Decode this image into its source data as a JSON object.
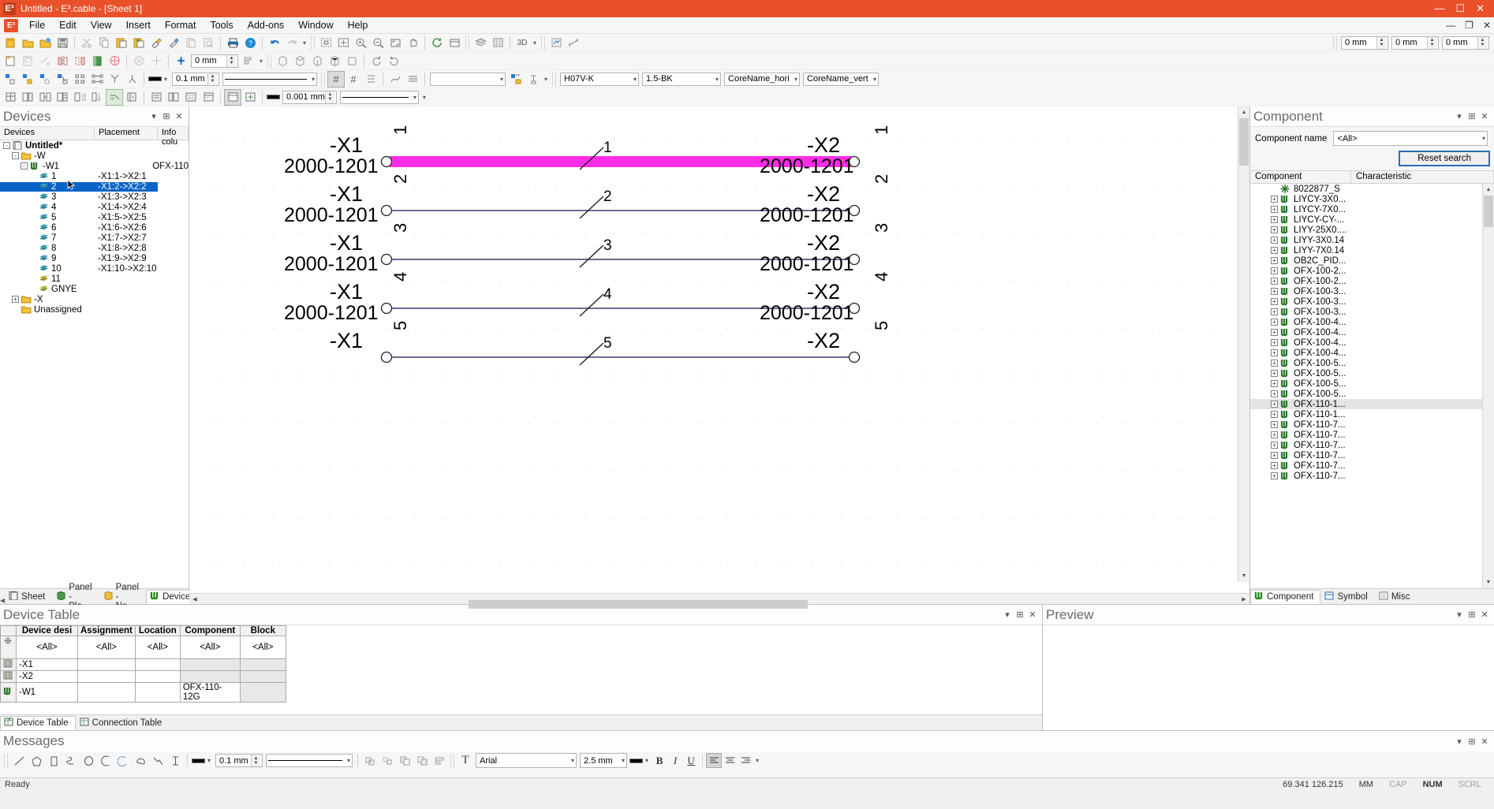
{
  "window": {
    "title": "Untitled - E³.cable - [Sheet 1]",
    "app_badge": "E³",
    "minimize": "—",
    "maximize": "☐",
    "close": "✕",
    "doc_minimize": "—",
    "doc_restore": "❐",
    "doc_close": "✕"
  },
  "menu": {
    "items": [
      "File",
      "Edit",
      "View",
      "Insert",
      "Format",
      "Tools",
      "Add-ons",
      "Window",
      "Help"
    ]
  },
  "toolbars": {
    "row2_value1": "0 mm",
    "row2_value2": "0 mm",
    "row2_value3": "0 mm",
    "row3_value": "0 mm",
    "row4_linewidth": "0.1 mm",
    "row5_value": "0.001 mm",
    "wire_type": "H07V-K",
    "wire_spec": "1.5-BK",
    "core_name_hori": "CoreName_hori",
    "core_name_vert": "CoreName_vert",
    "empty_combo": ""
  },
  "devices_panel": {
    "title": "Devices",
    "columns": [
      "Devices",
      "Placement",
      "Info colu"
    ],
    "tree": [
      {
        "label": "Untitled*",
        "placement": "",
        "info": "",
        "indent": 0,
        "expander": "-",
        "icon": "document-icon",
        "bold": true
      },
      {
        "label": "-W",
        "placement": "",
        "info": "",
        "indent": 1,
        "expander": "-",
        "icon": "folder-icon"
      },
      {
        "label": "-W1",
        "placement": "",
        "info": "OFX-110",
        "indent": 2,
        "expander": "-",
        "icon": "cable-icon"
      },
      {
        "label": "1",
        "placement": "-X1:1->X2:1",
        "info": "",
        "indent": 3,
        "expander": "",
        "icon": "core-icon"
      },
      {
        "label": "2",
        "placement": "-X1:2->X2:2",
        "info": "",
        "indent": 3,
        "expander": "",
        "icon": "core-icon",
        "selected": true
      },
      {
        "label": "3",
        "placement": "-X1:3->X2:3",
        "info": "",
        "indent": 3,
        "expander": "",
        "icon": "core-icon"
      },
      {
        "label": "4",
        "placement": "-X1:4->X2:4",
        "info": "",
        "indent": 3,
        "expander": "",
        "icon": "core-icon"
      },
      {
        "label": "5",
        "placement": "-X1:5->X2:5",
        "info": "",
        "indent": 3,
        "expander": "",
        "icon": "core-icon"
      },
      {
        "label": "6",
        "placement": "-X1:6->X2:6",
        "info": "",
        "indent": 3,
        "expander": "",
        "icon": "core-icon"
      },
      {
        "label": "7",
        "placement": "-X1:7->X2:7",
        "info": "",
        "indent": 3,
        "expander": "",
        "icon": "core-icon"
      },
      {
        "label": "8",
        "placement": "-X1:8->X2:8",
        "info": "",
        "indent": 3,
        "expander": "",
        "icon": "core-icon"
      },
      {
        "label": "9",
        "placement": "-X1:9->X2:9",
        "info": "",
        "indent": 3,
        "expander": "",
        "icon": "core-icon"
      },
      {
        "label": "10",
        "placement": "-X1:10->X2:10",
        "info": "",
        "indent": 3,
        "expander": "",
        "icon": "core-icon"
      },
      {
        "label": "11",
        "placement": "",
        "info": "",
        "indent": 3,
        "expander": "",
        "icon": "core-icon-yellow"
      },
      {
        "label": "GNYE",
        "placement": "",
        "info": "",
        "indent": 3,
        "expander": "",
        "icon": "core-icon-yellow"
      },
      {
        "label": "-X",
        "placement": "",
        "info": "",
        "indent": 1,
        "expander": "+",
        "icon": "folder-icon"
      },
      {
        "label": "Unassigned",
        "placement": "",
        "info": "",
        "indent": 1,
        "expander": "",
        "icon": "folder-icon"
      }
    ],
    "tabs": [
      {
        "label": "Sheet",
        "icon": "sheet-icon",
        "active": false
      },
      {
        "label": "Panel - Pla...",
        "icon": "panel-green-icon",
        "active": false
      },
      {
        "label": "Panel - No...",
        "icon": "panel-yellow-icon",
        "active": false
      },
      {
        "label": "Devices",
        "icon": "devices-icon",
        "active": true
      }
    ]
  },
  "canvas": {
    "highlight_color": "#ff2ee6",
    "wire_color": "#3a3a6e",
    "connections": [
      {
        "pin": "1",
        "left_device": "-X1",
        "left_code": "2000-1201",
        "right_device": "-X2",
        "right_code": "2000-1201",
        "mid_label": "1",
        "highlighted": true
      },
      {
        "pin": "2",
        "left_device": "-X1",
        "left_code": "2000-1201",
        "right_device": "-X2",
        "right_code": "2000-1201",
        "mid_label": "2",
        "highlighted": false
      },
      {
        "pin": "3",
        "left_device": "-X1",
        "left_code": "2000-1201",
        "right_device": "-X2",
        "right_code": "2000-1201",
        "mid_label": "3",
        "highlighted": false
      },
      {
        "pin": "4",
        "left_device": "-X1",
        "left_code": "2000-1201",
        "right_device": "-X2",
        "right_code": "2000-1201",
        "mid_label": "4",
        "highlighted": false
      },
      {
        "pin": "5",
        "left_device": "-X1",
        "left_code": "",
        "right_device": "-X2",
        "right_code": "",
        "mid_label": "5",
        "highlighted": false
      }
    ]
  },
  "component_panel": {
    "title": "Component",
    "name_label": "Component name",
    "name_value": "<All>",
    "reset_label": "Reset search",
    "columns": [
      "Component",
      "Characteristic"
    ],
    "items": [
      {
        "label": "8022877_S",
        "expander": "",
        "icon": "star-icon"
      },
      {
        "label": "LIYCY-3X0...",
        "expander": "+",
        "icon": "cable-icon"
      },
      {
        "label": "LIYCY-7X0...",
        "expander": "+",
        "icon": "cable-icon"
      },
      {
        "label": "LIYCY-CY-...",
        "expander": "+",
        "icon": "cable-icon"
      },
      {
        "label": "LIYY-25X0....",
        "expander": "+",
        "icon": "cable-icon"
      },
      {
        "label": "LIYY-3X0.14",
        "expander": "+",
        "icon": "cable-icon"
      },
      {
        "label": "LIYY-7X0.14",
        "expander": "+",
        "icon": "cable-icon"
      },
      {
        "label": "OB2C_PID...",
        "expander": "+",
        "icon": "cable-icon"
      },
      {
        "label": "OFX-100-2...",
        "expander": "+",
        "icon": "cable-icon"
      },
      {
        "label": "OFX-100-2...",
        "expander": "+",
        "icon": "cable-icon"
      },
      {
        "label": "OFX-100-3...",
        "expander": "+",
        "icon": "cable-icon"
      },
      {
        "label": "OFX-100-3...",
        "expander": "+",
        "icon": "cable-icon"
      },
      {
        "label": "OFX-100-3...",
        "expander": "+",
        "icon": "cable-icon"
      },
      {
        "label": "OFX-100-4...",
        "expander": "+",
        "icon": "cable-icon"
      },
      {
        "label": "OFX-100-4...",
        "expander": "+",
        "icon": "cable-icon"
      },
      {
        "label": "OFX-100-4...",
        "expander": "+",
        "icon": "cable-icon"
      },
      {
        "label": "OFX-100-4...",
        "expander": "+",
        "icon": "cable-icon"
      },
      {
        "label": "OFX-100-5...",
        "expander": "+",
        "icon": "cable-icon"
      },
      {
        "label": "OFX-100-5...",
        "expander": "+",
        "icon": "cable-icon"
      },
      {
        "label": "OFX-100-5...",
        "expander": "+",
        "icon": "cable-icon"
      },
      {
        "label": "OFX-100-5...",
        "expander": "+",
        "icon": "cable-icon"
      },
      {
        "label": "OFX-110-1...",
        "expander": "+",
        "icon": "cable-icon",
        "highlighted": true
      },
      {
        "label": "OFX-110-1...",
        "expander": "+",
        "icon": "cable-icon"
      },
      {
        "label": "OFX-110-7...",
        "expander": "+",
        "icon": "cable-icon"
      },
      {
        "label": "OFX-110-7...",
        "expander": "+",
        "icon": "cable-icon"
      },
      {
        "label": "OFX-110-7...",
        "expander": "+",
        "icon": "cable-icon"
      },
      {
        "label": "OFX-110-7...",
        "expander": "+",
        "icon": "cable-icon"
      },
      {
        "label": "OFX-110-7...",
        "expander": "+",
        "icon": "cable-icon"
      },
      {
        "label": "OFX-110-7...",
        "expander": "+",
        "icon": "cable-icon"
      }
    ],
    "tabs": [
      {
        "label": "Component",
        "icon": "component-icon",
        "active": true
      },
      {
        "label": "Symbol",
        "icon": "symbol-icon",
        "active": false
      },
      {
        "label": "Misc",
        "icon": "misc-icon",
        "active": false
      }
    ]
  },
  "device_table": {
    "title": "Device Table",
    "columns": [
      "Device desi",
      "Assignment",
      "Location",
      "Component",
      "Block"
    ],
    "filters": [
      "<All>",
      "<All>",
      "<All>",
      "<All>",
      "<All>"
    ],
    "rows": [
      {
        "icon": "terminal-icon",
        "cells": [
          "-X1",
          "",
          "",
          "",
          ""
        ]
      },
      {
        "icon": "terminal-icon",
        "cells": [
          "-X2",
          "",
          "",
          "",
          ""
        ]
      },
      {
        "icon": "cable-icon",
        "cells": [
          "-W1",
          "",
          "",
          "OFX-110-12G",
          ""
        ]
      }
    ],
    "tabs": [
      {
        "label": "Device Table",
        "icon": "device-table-icon",
        "active": true
      },
      {
        "label": "Connection Table",
        "icon": "connection-table-icon",
        "active": false
      }
    ]
  },
  "preview_panel": {
    "title": "Preview"
  },
  "messages_panel": {
    "title": "Messages",
    "font_family": "Arial",
    "font_size": "2.5 mm",
    "line_width": "0.1 mm",
    "bold": "B",
    "italic": "I",
    "underline": "U"
  },
  "status_bar": {
    "ready": "Ready",
    "coords": "69.341 126.215",
    "units": "MM",
    "cap": "CAP",
    "num": "NUM",
    "scrl": "SCRL"
  }
}
